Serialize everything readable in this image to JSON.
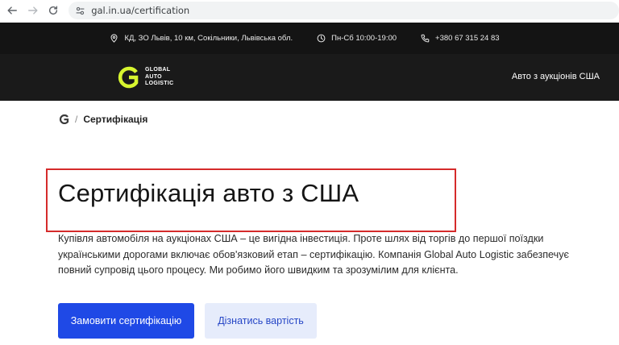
{
  "browser": {
    "url": "gal.in.ua/certification"
  },
  "info_strip": {
    "address": "КД, ЗО Львів, 10 км, Сокільники, Львівська обл.",
    "hours": "Пн-Сб 10:00-19:00",
    "phone": "+380 67 315 24 83"
  },
  "header": {
    "logo_lines": [
      "GLOBAL",
      "AUTO",
      "LOGISTIC"
    ],
    "nav_link": "Авто з аукціонів США"
  },
  "breadcrumb": {
    "separator": "/",
    "current": "Сертифікація"
  },
  "main": {
    "title": "Сертифікація авто з США",
    "intro": "Купівля автомобіля на аукціонах США – це вигідна інвестиція. Проте шлях від торгів до першої поїздки українськими дорогами включає обов'язковий етап – сертифікацію. Компанія Global Auto Logistic забезпечує повний супровід цього процесу. Ми робимо його швидким та зрозумілим для клієнта.",
    "primary_button": "Замовити сертифікацію",
    "secondary_button": "Дізнатись вартість"
  },
  "colors": {
    "accent": "#1f49e6",
    "logo_accent": "#d7f52f",
    "highlight_frame": "#d52b2b"
  }
}
